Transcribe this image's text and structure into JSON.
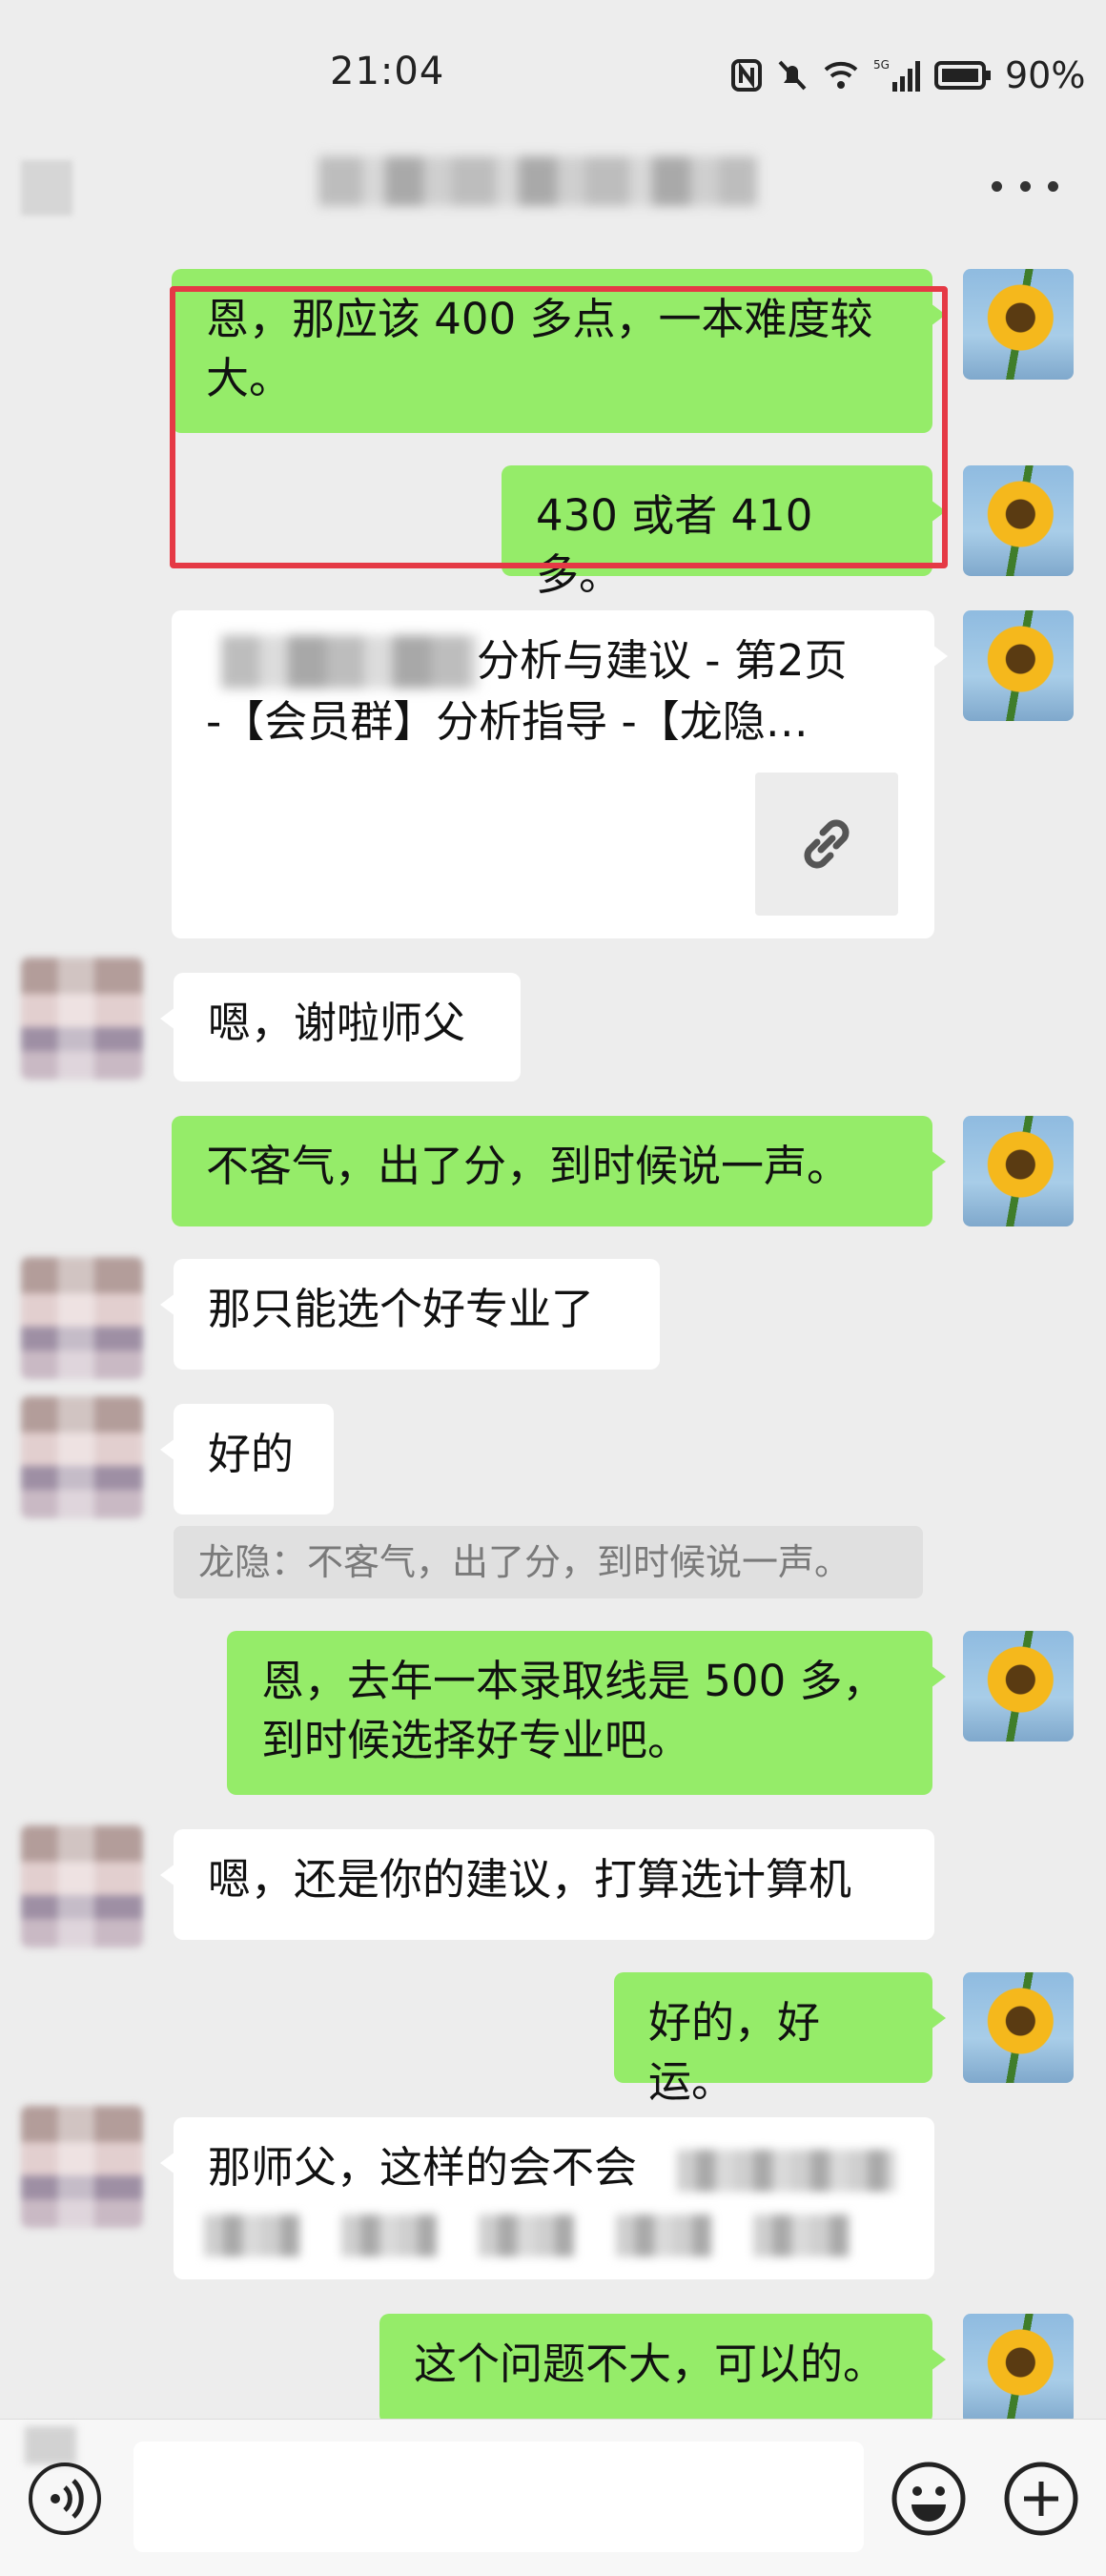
{
  "status_bar": {
    "time": "21:04",
    "icons": [
      "nfc-icon",
      "mute-bell-icon",
      "wifi-icon",
      "signal-5g-icon",
      "battery-icon"
    ],
    "battery": "90%"
  },
  "nav": {
    "back_icon": "back-icon",
    "more_icon": "more-dots-icon"
  },
  "messages": {
    "m1": "恩，那应该 400 多点，一本难度较大。",
    "m2": "430 或者 410 多。",
    "card": {
      "title": "分析与建议 - 第2页",
      "subtitle": "-【会员群】分析指导 -【龙隐…",
      "icon": "link-icon"
    },
    "m3": "嗯，谢啦师父",
    "m4": "不客气，出了分，到时候说一声。",
    "m5": "那只能选个好专业了",
    "m6": "好的",
    "quote": "龙隐：不客气，出了分，到时候说一声。",
    "m7": "恩，去年一本录取线是 500 多，到时候选择好专业吧。",
    "m8": "嗯，还是你的建议，打算选计算机",
    "m9": "好的，好运。",
    "m10": "那师父，这样的会不会",
    "m11": "这个问题不大，可以的。"
  },
  "colors": {
    "bubble_self": "#95ec69",
    "bubble_other": "#ffffff",
    "background": "#ededed",
    "highlight_box": "#e53945"
  },
  "bottom_bar": {
    "voice_icon": "voice-icon",
    "emoji_icon": "emoji-icon",
    "plus_icon": "plus-icon"
  }
}
